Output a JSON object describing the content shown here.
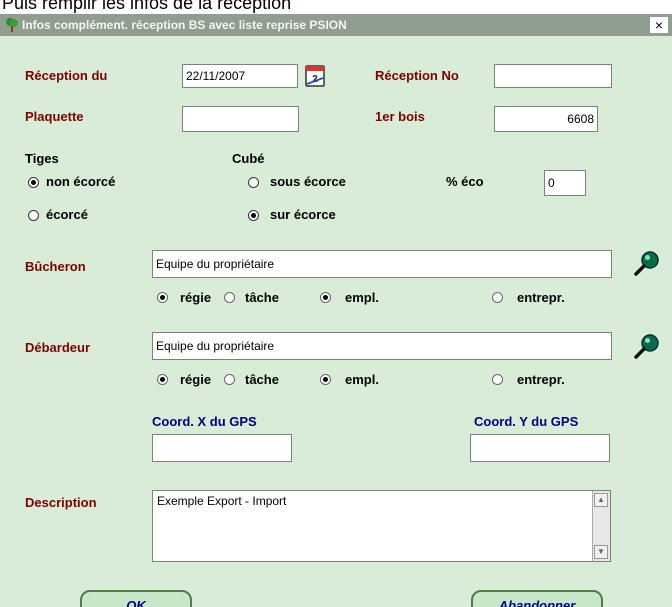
{
  "caption": "Puis remplir les infos de la réception",
  "window": {
    "title": "Infos complément. réception BS avec liste reprise PSION",
    "close_glyph": "×"
  },
  "reception_du": {
    "label": "Réception du",
    "value": "22/11/2007"
  },
  "reception_no": {
    "label": "Réception No",
    "value": ""
  },
  "plaquette": {
    "label": "Plaquette",
    "value": ""
  },
  "premier_bois": {
    "label": "1er bois",
    "value": "6608"
  },
  "tiges": {
    "label": "Tiges",
    "options": [
      "non écorcé",
      "écorcé"
    ],
    "selected": "non écorcé"
  },
  "cube": {
    "label": "Cubé",
    "options": [
      "sous écorce",
      "sur écorce"
    ],
    "selected": "sur écorce"
  },
  "pct_eco": {
    "label": "% éco",
    "value": "0"
  },
  "bucheron": {
    "label": "Bûcheron",
    "value": "Equipe du propriétaire",
    "mode_options": [
      "régie",
      "tâche"
    ],
    "mode_selected": "régie",
    "type_options": [
      "empl.",
      "entrepr."
    ],
    "type_selected": "empl."
  },
  "debardeur": {
    "label": "Débardeur",
    "value": "Equipe du propriétaire",
    "mode_options": [
      "régie",
      "tâche"
    ],
    "mode_selected": "régie",
    "type_options": [
      "empl.",
      "entrepr."
    ],
    "type_selected": "empl."
  },
  "gps": {
    "x_label": "Coord. X du GPS",
    "x_value": "",
    "y_label": "Coord. Y du GPS",
    "y_value": ""
  },
  "description": {
    "label": "Description",
    "value": "Exemple Export - Import"
  },
  "buttons": {
    "ok": "OK",
    "abandon": "Abandonner"
  },
  "icons": {
    "window": "tree-icon",
    "calendar": "calendar-icon",
    "search": "magnifier-icon"
  },
  "colors": {
    "background": "#d8ecd8",
    "title_bar": "#8f9e8f",
    "label_primary": "#800000",
    "label_secondary": "#000080"
  }
}
